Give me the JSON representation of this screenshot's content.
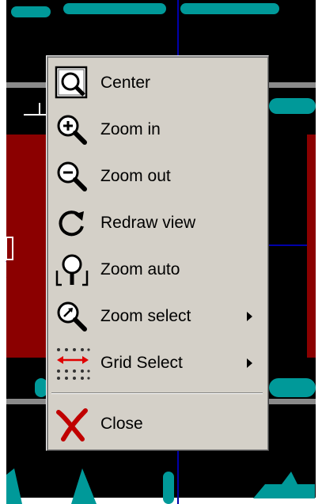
{
  "canvas": {
    "background": "#000000",
    "pad_color": "#009999",
    "fill_color": "#8b0000",
    "track_color": "#0000aa",
    "rail_color": "#8a8a8a"
  },
  "menu": {
    "items": [
      {
        "label": "Center",
        "icon": "center-icon"
      },
      {
        "label": "Zoom in",
        "icon": "zoom-in-icon"
      },
      {
        "label": "Zoom out",
        "icon": "zoom-out-icon"
      },
      {
        "label": "Redraw view",
        "icon": "redraw-icon"
      },
      {
        "label": "Zoom auto",
        "icon": "zoom-auto-icon"
      },
      {
        "label": "Zoom select",
        "icon": "zoom-select-icon",
        "submenu": true
      },
      {
        "label": "Grid Select",
        "icon": "grid-icon",
        "submenu": true
      },
      {
        "label": "Close",
        "icon": "close-icon"
      }
    ]
  }
}
